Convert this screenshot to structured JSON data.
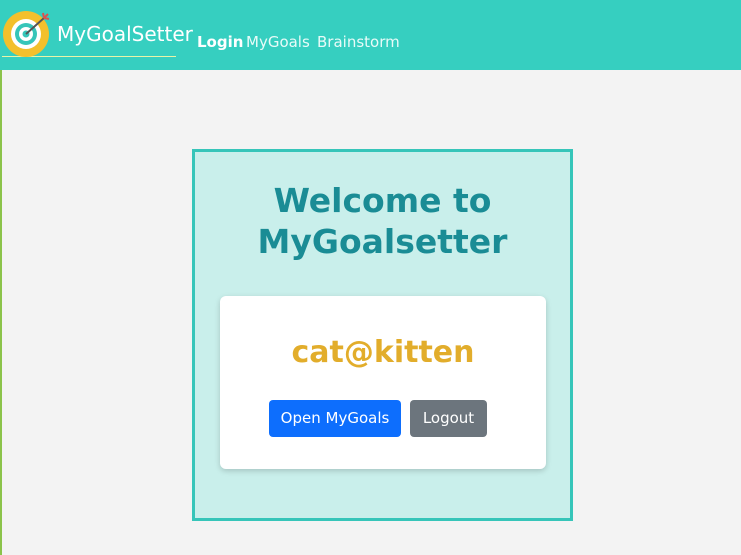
{
  "header": {
    "brand_name": "MyGoalSetter",
    "logo_icon": "target-dart-icon",
    "nav": {
      "login": "Login",
      "mygoals": "MyGoals",
      "brainstorm": "Brainstorm"
    }
  },
  "main": {
    "welcome_line1": "Welcome to",
    "welcome_line2": "MyGoalsetter",
    "card": {
      "username": "cat@kitten",
      "open_button": "Open MyGoals",
      "logout_button": "Logout"
    }
  },
  "colors": {
    "navbar": "#36cfc0",
    "panel_bg": "#c9efeb",
    "panel_border": "#36c5b9",
    "welcome_text": "#1a8c95",
    "username_text": "#e2ad2b",
    "primary_button": "#0d6efd",
    "secondary_button": "#6c757d"
  }
}
